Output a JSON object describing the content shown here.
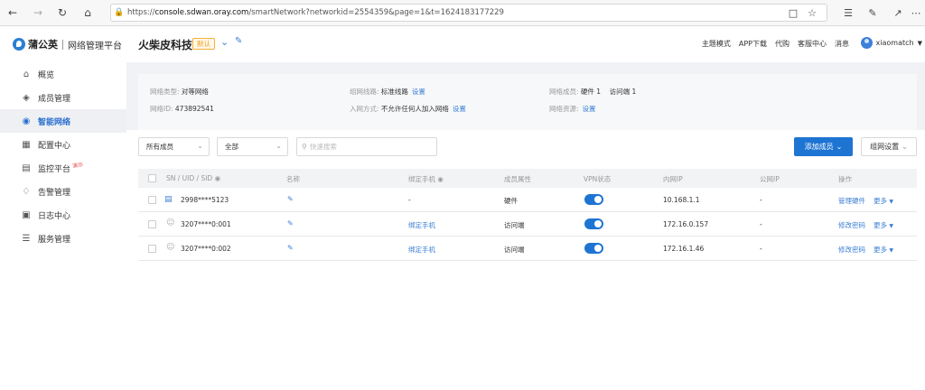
{
  "browser": {
    "url_prefix": "https://",
    "url_host": "console.sdwan.oray.com",
    "url_path": "/smartNetwork?networkid=2554359&page=1&t=1624183177229"
  },
  "header": {
    "logo_name": "蒲公英",
    "logo_sub": "网络管理平台",
    "network_title": "火柴皮科技",
    "badge": "默认",
    "links": [
      "主题模式",
      "APP下载",
      "代购",
      "客服中心",
      "消息"
    ],
    "username": "xiaomatch"
  },
  "sidebar": {
    "items": [
      {
        "label": "概览",
        "icon": "home-icon"
      },
      {
        "label": "成员管理",
        "icon": "layers-icon"
      },
      {
        "label": "智能网络",
        "icon": "network-icon"
      },
      {
        "label": "配置中心",
        "icon": "grid-icon"
      },
      {
        "label": "监控平台",
        "icon": "monitor-icon"
      },
      {
        "label": "告警管理",
        "icon": "bell-icon"
      },
      {
        "label": "日志中心",
        "icon": "calendar-icon"
      },
      {
        "label": "服务管理",
        "icon": "document-icon"
      }
    ],
    "demo_tag": "演示"
  },
  "info": {
    "type_k": "网络类型:",
    "type_v": "对等网络",
    "id_k": "网络ID:",
    "id_v": "473892541",
    "line_k": "组网线路:",
    "line_v": "标准线路",
    "line_link": "设置",
    "join_k": "入网方式:",
    "join_v": "不允许任何人加入网络",
    "join_link": "设置",
    "members_k": "网络成员:",
    "members_v": "硬件 1    访问端 1",
    "res_k": "网络资源:",
    "res_link": "设置"
  },
  "toolbar": {
    "filter_member": "所有成员",
    "filter_all": "全部",
    "search_placeholder": "快速搜索",
    "add_member": "添加成员",
    "group_settings": "组网设置"
  },
  "table": {
    "headers": {
      "sn": "SN / UID / SID",
      "name": "名称",
      "phone": "绑定手机",
      "attr": "成员属性",
      "vpn": "VPN状态",
      "lan_ip": "内网IP",
      "public_ip": "公网IP",
      "ops": "操作"
    },
    "rows": [
      {
        "sn": "2998****5123",
        "phone": "-",
        "attr": "硬件",
        "lan_ip": "10.168.1.1",
        "public_ip": "-",
        "op1": "管理硬件",
        "op2": "更多"
      },
      {
        "sn": "3207****0:001",
        "phone": "绑定手机",
        "attr": "访问端",
        "lan_ip": "172.16.0.157",
        "public_ip": "-",
        "op1": "修改密码",
        "op2": "更多"
      },
      {
        "sn": "3207****0:002",
        "phone": "绑定手机",
        "attr": "访问端",
        "lan_ip": "172.16.1.46",
        "public_ip": "-",
        "op1": "修改密码",
        "op2": "更多"
      }
    ]
  },
  "colors": {
    "accent": "#1e74d3",
    "link": "#3a7fd5",
    "badge": "#f0a020"
  }
}
